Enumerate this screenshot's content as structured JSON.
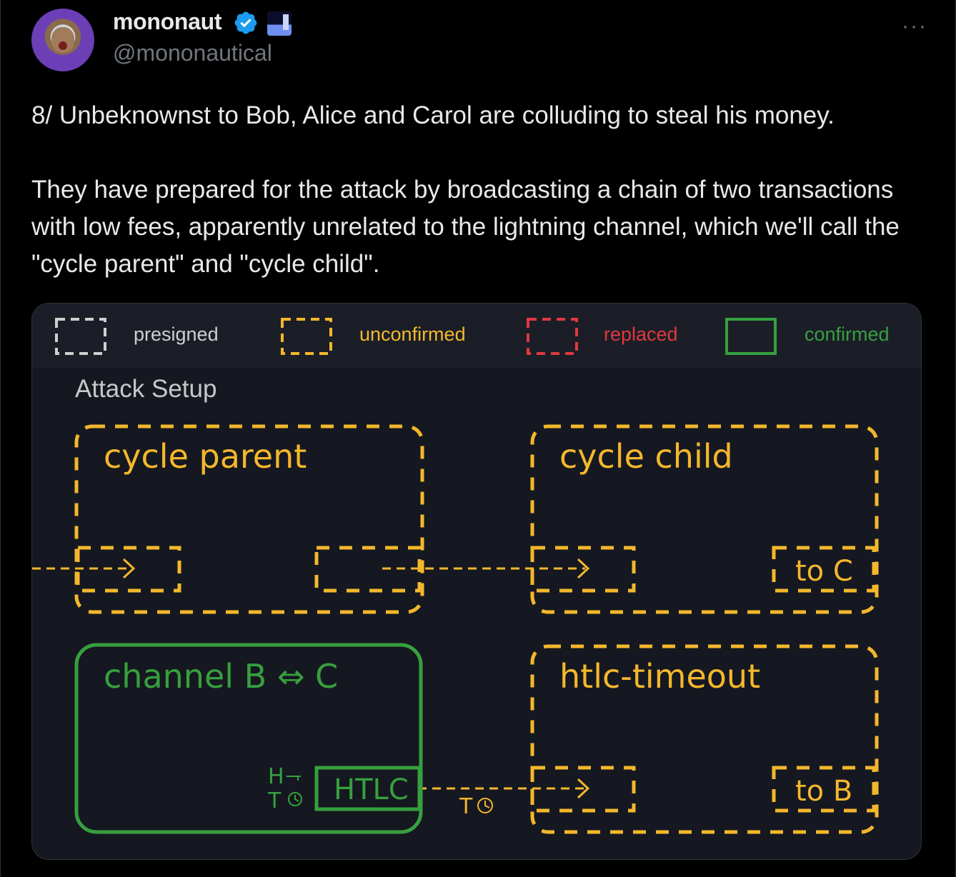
{
  "author": {
    "display_name": "mononaut",
    "handle": "@mononautical",
    "verified_icon": "verified-badge-icon",
    "affiliate_icon": "affiliate-badge-icon"
  },
  "menu": {
    "more_label": "···"
  },
  "tweet": {
    "text": "8/ Unbeknownst to Bob, Alice and Carol are colluding to steal his money.\n\nThey have prepared for the attack by broadcasting a chain of two transactions with low fees, apparently unrelated to the lightning channel, which we'll call the \"cycle parent\" and \"cycle child\"."
  },
  "colors": {
    "presigned": "#cfcfcf",
    "unconfirmed": "#f4b72c",
    "replaced": "#e0393e",
    "confirmed": "#36a03e",
    "background": "#151820"
  },
  "media": {
    "legend": {
      "presigned": "presigned",
      "unconfirmed": "unconfirmed",
      "replaced": "replaced",
      "confirmed": "confirmed"
    },
    "section_title": "Attack Setup",
    "boxes": {
      "cycle_parent": "cycle parent",
      "cycle_child": "cycle child",
      "channel": "channel B ⇔ C",
      "htlc_timeout": "htlc-timeout",
      "htlc": "HTLC",
      "to_c": "to C",
      "to_b": "to B",
      "hash_lock": "H",
      "time_lock": "T",
      "timeout_arrow_label": "T"
    }
  }
}
